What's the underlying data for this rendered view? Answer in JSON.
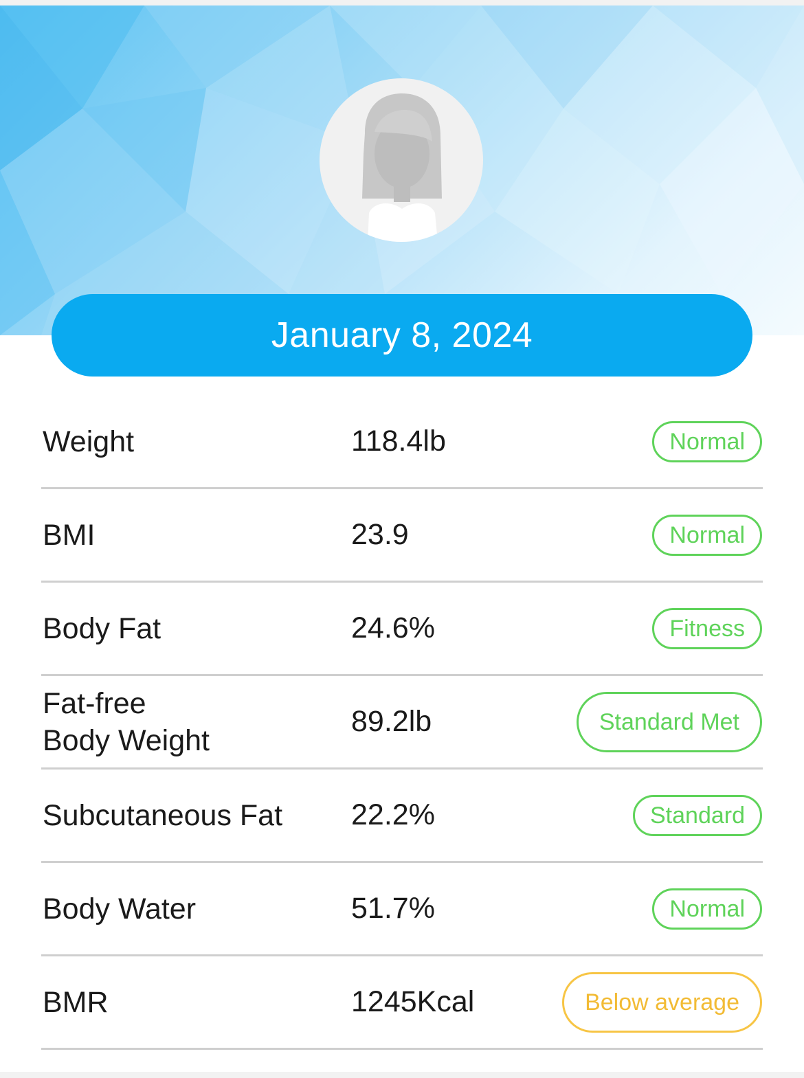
{
  "header": {
    "date": "January 8, 2024",
    "avatar_icon": "female-avatar-icon"
  },
  "colors": {
    "accent_blue": "#0aaaf0",
    "status_green": "#5fd35a",
    "status_yellow": "#f2bb35",
    "divider": "#cfcfcf"
  },
  "metrics": [
    {
      "label": "Weight",
      "value": "118.4lb",
      "status": "Normal",
      "status_color": "green"
    },
    {
      "label": "BMI",
      "value": "23.9",
      "status": "Normal",
      "status_color": "green"
    },
    {
      "label": "Body Fat",
      "value": "24.6%",
      "status": "Fitness",
      "status_color": "green"
    },
    {
      "label": "Fat-free\nBody Weight",
      "value": "89.2lb",
      "status": "Standard Met",
      "status_color": "green"
    },
    {
      "label": "Subcutaneous Fat",
      "value": "22.2%",
      "status": "Standard",
      "status_color": "green"
    },
    {
      "label": "Body Water",
      "value": "51.7%",
      "status": "Normal",
      "status_color": "green"
    },
    {
      "label": "BMR",
      "value": "1245Kcal",
      "status": "Below average",
      "status_color": "yellow"
    }
  ]
}
